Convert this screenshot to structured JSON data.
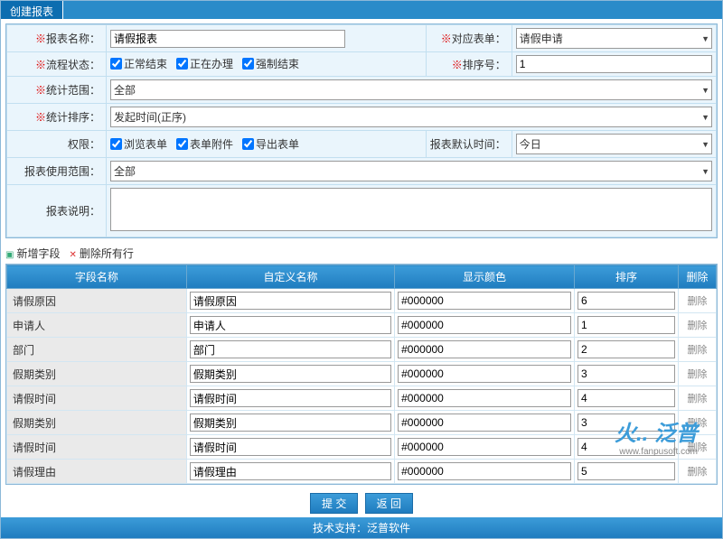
{
  "tab_title": "创建报表",
  "form": {
    "report_name": {
      "label": "报表名称：",
      "value": "请假报表",
      "required": true
    },
    "target_form": {
      "label": "对应表单：",
      "value": "请假申请",
      "required": true
    },
    "flow_state": {
      "label": "流程状态：",
      "required": true,
      "options": [
        {
          "label": "正常结束",
          "checked": true
        },
        {
          "label": "正在办理",
          "checked": true
        },
        {
          "label": "强制结束",
          "checked": true
        }
      ]
    },
    "sort_no": {
      "label": "排序号：",
      "value": "1",
      "required": true
    },
    "stat_scope": {
      "label": "统计范围：",
      "value": "全部",
      "required": true
    },
    "stat_order": {
      "label": "统计排序：",
      "value": "发起时间(正序)",
      "required": true
    },
    "permission": {
      "label": "权限：",
      "options": [
        {
          "label": "浏览表单",
          "checked": true
        },
        {
          "label": "表单附件",
          "checked": true
        },
        {
          "label": "导出表单",
          "checked": true
        }
      ]
    },
    "default_time": {
      "label": "报表默认时间：",
      "value": "今日"
    },
    "use_scope": {
      "label": "报表使用范围：",
      "value": "全部"
    },
    "remark": {
      "label": "报表说明：",
      "value": ""
    }
  },
  "actions": {
    "add": "新增字段",
    "del_all": "删除所有行"
  },
  "grid": {
    "headers": {
      "name": "字段名称",
      "alias": "自定义名称",
      "color": "显示颜色",
      "order": "排序",
      "del": "删除"
    },
    "rows": [
      {
        "name": "请假原因",
        "alias": "请假原因",
        "color": "#000000",
        "order": "6"
      },
      {
        "name": "申请人",
        "alias": "申请人",
        "color": "#000000",
        "order": "1"
      },
      {
        "name": "部门",
        "alias": "部门",
        "color": "#000000",
        "order": "2"
      },
      {
        "name": "假期类别",
        "alias": "假期类别",
        "color": "#000000",
        "order": "3"
      },
      {
        "name": "请假时间",
        "alias": "请假时间",
        "color": "#000000",
        "order": "4"
      },
      {
        "name": "假期类别",
        "alias": "假期类别",
        "color": "#000000",
        "order": "3"
      },
      {
        "name": "请假时间",
        "alias": "请假时间",
        "color": "#000000",
        "order": "4"
      },
      {
        "name": "请假理由",
        "alias": "请假理由",
        "color": "#000000",
        "order": "5"
      }
    ],
    "row_delete_label": "删除"
  },
  "buttons": {
    "submit": "提 交",
    "back": "返 回"
  },
  "support": "技术支持：泛普软件",
  "watermark": {
    "main": "火.. 泛普",
    "sub": "www.fanpusoft.com"
  }
}
